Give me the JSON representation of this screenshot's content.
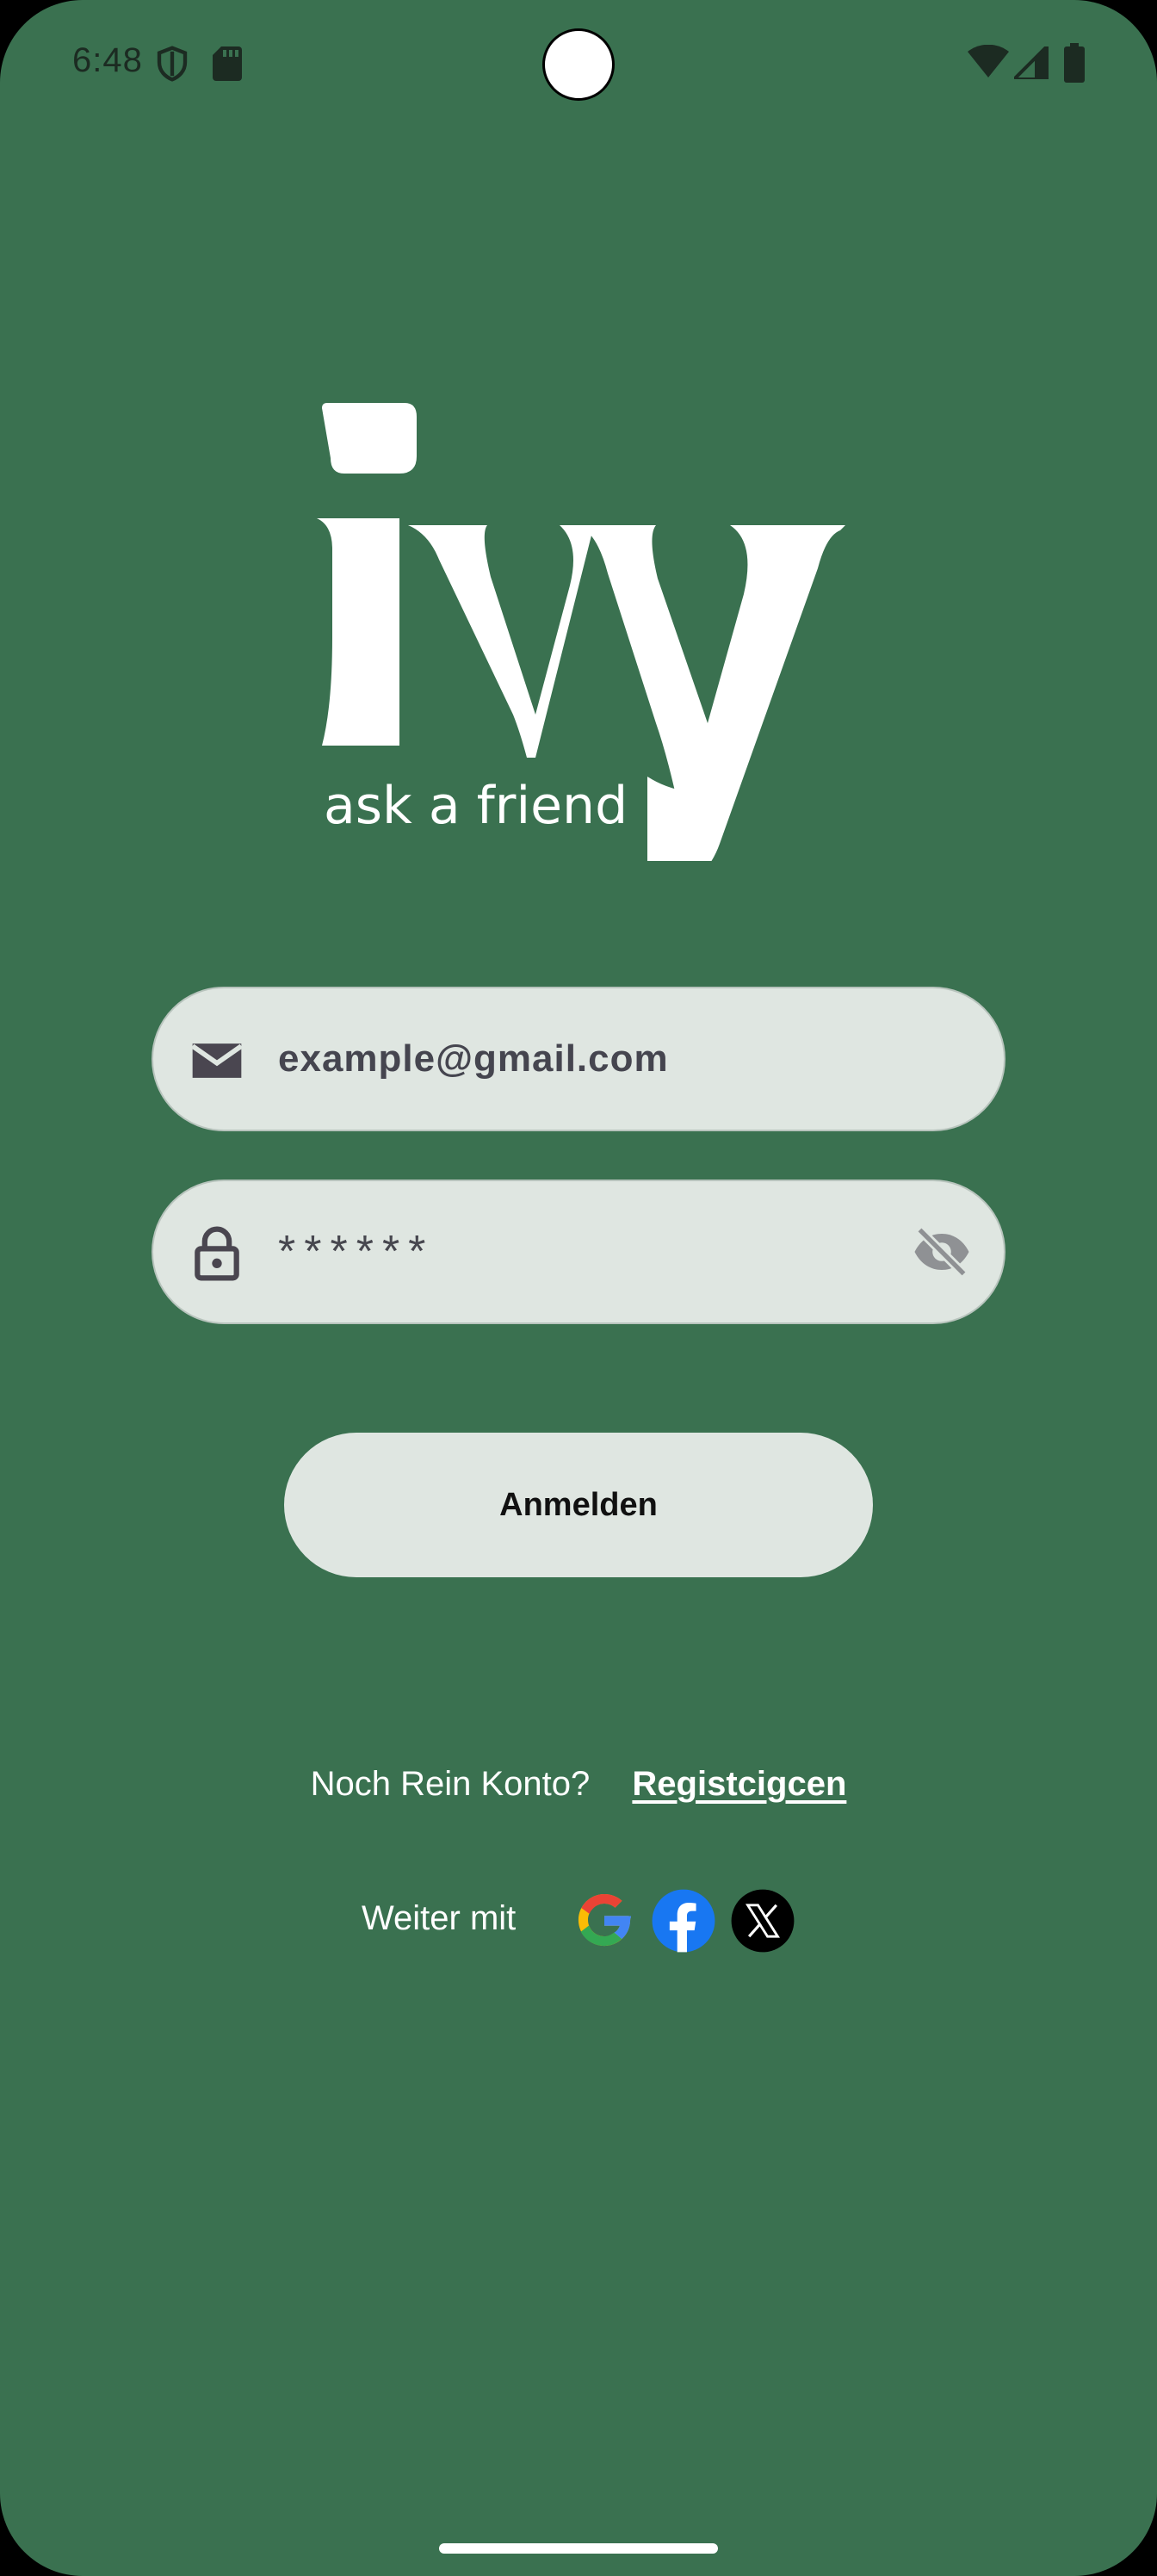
{
  "status_bar": {
    "time": "6:48"
  },
  "logo": {
    "wordmark": "ivy",
    "tagline": "ask a friend"
  },
  "login_form": {
    "email_value": "example@gmail.com",
    "password_masked": "******",
    "submit_label": "Anmelden"
  },
  "register": {
    "question": "Noch Rein Konto?",
    "link_label": "Registcigcen"
  },
  "social": {
    "label": "Weiter mit",
    "providers": [
      "google-icon",
      "facebook-icon",
      "x-icon"
    ]
  },
  "colors": {
    "background": "#3a7150",
    "field_background": "#dfe6e1",
    "text_light": "#ffffff",
    "facebook": "#1877f2"
  }
}
